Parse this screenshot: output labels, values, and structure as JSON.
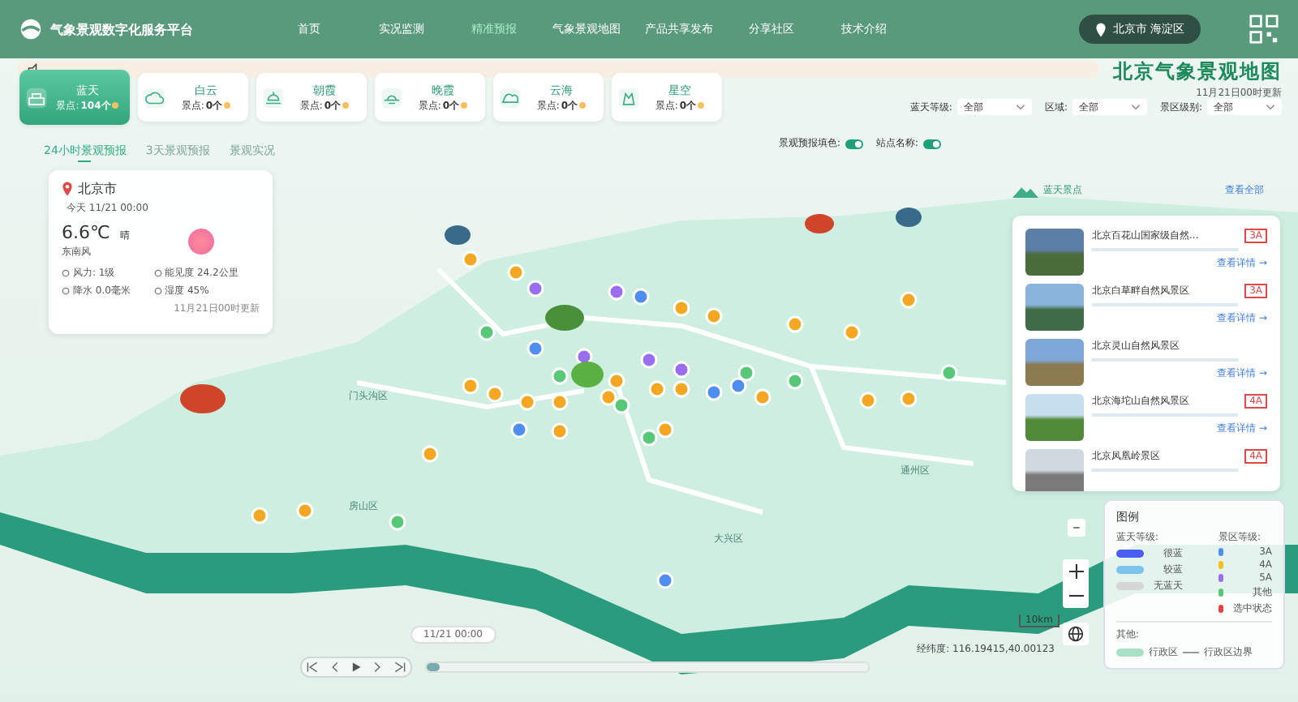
{
  "header": {
    "title": "气象景观数字化服务平台",
    "nav": [
      {
        "label": "首页",
        "selected": false
      },
      {
        "label": "实况监测",
        "selected": false
      },
      {
        "label": "精准预报",
        "selected": true
      },
      {
        "label": "气象景观地图",
        "selected": false
      },
      {
        "label": "产品共享发布",
        "selected": false
      },
      {
        "label": "分享社区",
        "selected": false
      },
      {
        "label": "技术介绍",
        "selected": false
      }
    ],
    "location": "北京市 海淀区"
  },
  "page_title": "北京气象景观地图",
  "updated": "11月21日00时更新",
  "categories": [
    {
      "name": "蓝天",
      "count_label": "景点:",
      "count": "104个",
      "selected": true
    },
    {
      "name": "白云",
      "count_label": "景点:",
      "count": "0个",
      "selected": false
    },
    {
      "name": "朝霞",
      "count_label": "景点:",
      "count": "0个",
      "selected": false
    },
    {
      "name": "晚霞",
      "count_label": "景点:",
      "count": "0个",
      "selected": false
    },
    {
      "name": "云海",
      "count_label": "景点:",
      "count": "0个",
      "selected": false
    },
    {
      "name": "星空",
      "count_label": "景点:",
      "count": "0个",
      "selected": false
    }
  ],
  "filters": [
    {
      "label": "蓝天等级:",
      "value": "全部"
    },
    {
      "label": "区域:",
      "value": "全部"
    },
    {
      "label": "景区级别:",
      "value": "全部"
    }
  ],
  "tabs": [
    {
      "label": "24小时景观预报",
      "selected": true
    },
    {
      "label": "3天景观预报",
      "selected": false
    },
    {
      "label": "景观实况",
      "selected": false
    }
  ],
  "toggles": [
    {
      "label": "景观预报填色:",
      "on": true
    },
    {
      "label": "站点名称:",
      "on": true
    }
  ],
  "weather": {
    "city": "北京市",
    "time": "今天 11/21 00:00",
    "temperature": "6.6℃",
    "condition": "晴",
    "wind_dir": "东南风",
    "details": [
      "风力: 1级",
      "能见度 24.2公里",
      "降水 0.0毫米",
      "湿度 45%"
    ],
    "updated": "11月21日00时更新"
  },
  "spots": {
    "title": "蓝天景点",
    "view_all": "查看全部",
    "items": [
      {
        "name": "北京百花山国家级自然...",
        "grade": "3A",
        "link": "查看详情 →"
      },
      {
        "name": "北京白草畔自然风景区",
        "grade": "3A",
        "link": "查看详情 →"
      },
      {
        "name": "北京灵山自然风景区",
        "link": "查看详情 →"
      },
      {
        "name": "北京海坨山自然风景区",
        "grade": "4A",
        "link": "查看详情 →"
      },
      {
        "name": "北京凤凰岭景区",
        "grade": "4A"
      }
    ]
  },
  "map_labels": [
    "门头沟区",
    "房山区",
    "大兴区",
    "通州区"
  ],
  "legend": {
    "title": "图例",
    "sky_title": "蓝天等级:",
    "sky": [
      {
        "label": "很蓝",
        "color": "#4a5ff0"
      },
      {
        "label": "较蓝",
        "color": "#7cc4f0"
      },
      {
        "label": "无蓝天",
        "color": "#d6d6d6"
      }
    ],
    "grade_title": "景区等级:",
    "grades": [
      {
        "label": "3A",
        "color": "#4f8ef0"
      },
      {
        "label": "4A",
        "color": "#f4c020"
      },
      {
        "label": "5A",
        "color": "#9a6ef0"
      },
      {
        "label": "其他",
        "color": "#56c878"
      },
      {
        "label": "选中状态",
        "color": "#e84040"
      }
    ],
    "other_title": "其他:",
    "region": "行政区",
    "boundary": "行政区边界"
  },
  "scale": "10km",
  "coordinates": "经纬度: 116.19415,40.00123",
  "timeline": {
    "time": "11/21 00:00",
    "level": 0.03
  }
}
